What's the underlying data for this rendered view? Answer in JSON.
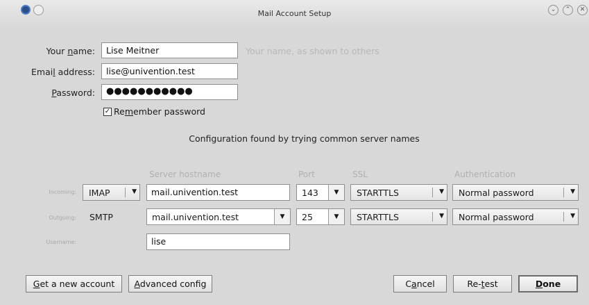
{
  "window": {
    "title": "Mail Account Setup"
  },
  "form": {
    "name_label_pre": "Your ",
    "name_label_key": "n",
    "name_label_post": "ame:",
    "name_value": "Lise Meitner",
    "name_hint": "Your name, as shown to others",
    "email_label_pre": "Emai",
    "email_label_key": "l",
    "email_label_post": " address:",
    "email_value": "lise@univention.test",
    "password_label_key": "P",
    "password_label_post": "assword:",
    "password_value": "●●●●●●●●●●●",
    "remember_check": "✓",
    "remember_pre": "Re",
    "remember_key": "m",
    "remember_post": "ember password"
  },
  "status": "Configuration found by trying common server names",
  "server_table": {
    "headers": {
      "hostname": "Server hostname",
      "port": "Port",
      "ssl": "SSL",
      "auth": "Authentication"
    },
    "incoming": {
      "label": "Incoming:",
      "protocol": "IMAP",
      "hostname": "mail.univention.test",
      "port": "143",
      "ssl": "STARTTLS",
      "auth": "Normal password"
    },
    "outgoing": {
      "label": "Outgoing:",
      "protocol": "SMTP",
      "hostname": "mail.univention.test",
      "port": "25",
      "ssl": "STARTTLS",
      "auth": "Normal password"
    },
    "username": {
      "label": "Username:",
      "value": "lise"
    }
  },
  "buttons": {
    "new_account_key": "G",
    "new_account_post": "et a new account",
    "advanced_key": "A",
    "advanced_post": "dvanced config",
    "cancel_pre": "C",
    "cancel_key": "a",
    "cancel_post": "ncel",
    "retest_pre": "Re-",
    "retest_key": "t",
    "retest_post": "est",
    "done_key": "D",
    "done_post": "one"
  },
  "icons": {
    "app": "thunderbird-icon",
    "arrow": "▼",
    "minimize": "⌄",
    "maximize": "⌃",
    "close": "✕"
  }
}
